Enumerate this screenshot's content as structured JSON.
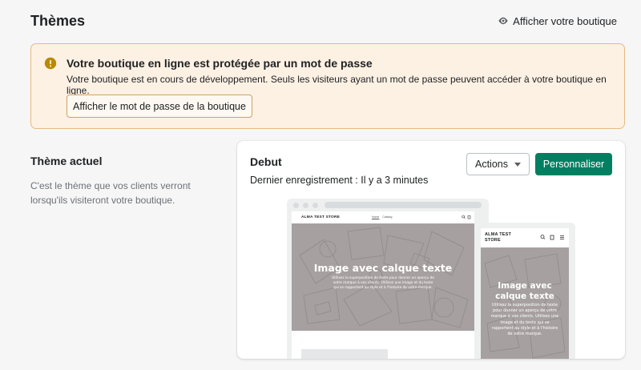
{
  "header": {
    "title": "Thèmes",
    "view_store_label": "Afficher votre boutique",
    "view_store_icon": "eye-icon"
  },
  "banner": {
    "icon": "warning-icon",
    "title": "Votre boutique en ligne est protégée par un mot de passe",
    "text": "Votre boutique est en cours de développement. Seuls les visiteurs ayant un mot de passe peuvent accéder à votre boutique en ligne.",
    "button_label": "Afficher le mot de passe de la boutique",
    "accent": "#b98900"
  },
  "current_theme": {
    "section_title": "Thème actuel",
    "section_description": "C'est le thème que vos clients verront lorsqu'ils visiteront votre boutique.",
    "theme_name": "Debut",
    "last_saved": "Dernier enregistrement : Il y a 3 minutes",
    "actions_label": "Actions",
    "customize_label": "Personnaliser",
    "customize_color": "#008060"
  },
  "preview": {
    "store_name": "ALMA TEST STORE",
    "nav_links": [
      "Home",
      "Catalog"
    ],
    "hero_heading": "Image avec calque texte",
    "hero_subtext_desktop": [
      "Utilisez la superposition de texte pour donner un aperçu de",
      "votre marque à vos clients. Utilisez une image et du texte",
      "qui se rapportent au style et à l'histoire de votre marque."
    ],
    "hero_subtext_mobile": [
      "Utilisez la superposition de texte",
      "pour donner un aperçu de votre",
      "marque à vos clients. Utilisez une",
      "image et du texte qui se",
      "rapportent au style et à l'histoire",
      "de votre marque."
    ],
    "mobile_heading_lines": [
      "Image avec",
      "calque texte"
    ],
    "mobile_logo_lines": [
      "ALMA TEST",
      "STORE"
    ]
  }
}
